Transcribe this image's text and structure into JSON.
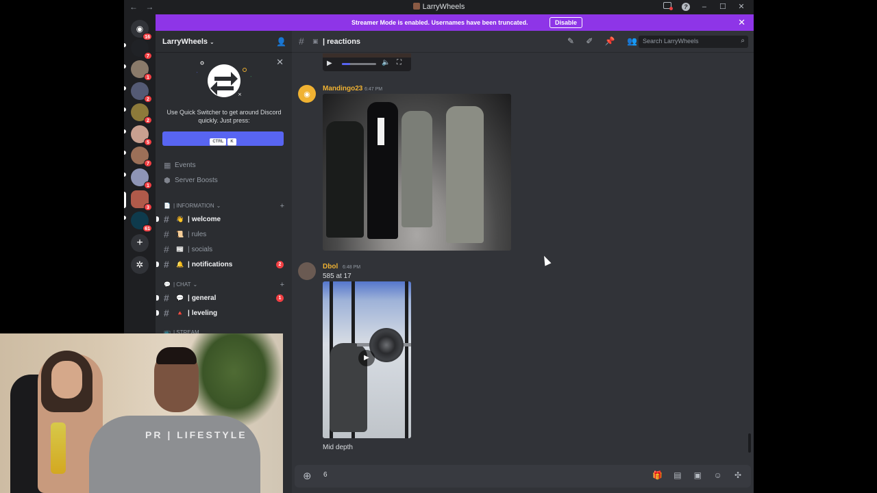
{
  "titlebar": {
    "title": "LarryWheels",
    "back": "←",
    "forward": "→"
  },
  "banner": {
    "message": "Streamer Mode is enabled. Usernames have been truncated.",
    "disable_label": "Disable",
    "close": "✕"
  },
  "guild_badges": [
    "16",
    "7",
    "1",
    "2",
    "2",
    "5",
    "7",
    "1",
    "3",
    "61"
  ],
  "server": {
    "name": "LarryWheels"
  },
  "quick_switcher": {
    "text": "Use Quick Switcher to get around Discord quickly. Just press:",
    "keys": [
      "CTRL",
      "K"
    ]
  },
  "sidebar_misc": [
    {
      "label": "Events",
      "icon": "calendar-icon"
    },
    {
      "label": "Server Boosts",
      "icon": "boost-icon"
    }
  ],
  "categories": [
    {
      "label": "| INFORMATION"
    },
    {
      "label": "| CHAT"
    },
    {
      "label": "| STREAM"
    }
  ],
  "channels": [
    {
      "emoji": "👋",
      "name": "welcome",
      "unread": true,
      "badge": ""
    },
    {
      "emoji": "📜",
      "name": "rules",
      "unread": false,
      "badge": ""
    },
    {
      "emoji": "📰",
      "name": "socials",
      "unread": false,
      "badge": ""
    },
    {
      "emoji": "🔔",
      "name": "notifications",
      "unread": true,
      "badge": "2"
    },
    {
      "emoji": "💬",
      "name": "general",
      "unread": true,
      "badge": "1"
    },
    {
      "emoji": "🔺",
      "name": "leveling",
      "unread": true,
      "badge": ""
    }
  ],
  "chat_header": {
    "channel": "| reactions",
    "search_placeholder": "Search LarryWheels"
  },
  "messages": [
    {
      "author": "Mandingo23",
      "time": "6:47 PM",
      "text": ""
    },
    {
      "author": "Dbol",
      "time": "6:48 PM",
      "text": "585 at 17",
      "caption": "Mid depth"
    }
  ],
  "composer": {
    "value": "6"
  },
  "colors": {
    "accent": "#5865f2",
    "banner": "#8e35e7",
    "author": "#f0b232",
    "badge": "#f23f43"
  },
  "webcam": {
    "shirt_text": "PR | LIFESTYLE"
  }
}
